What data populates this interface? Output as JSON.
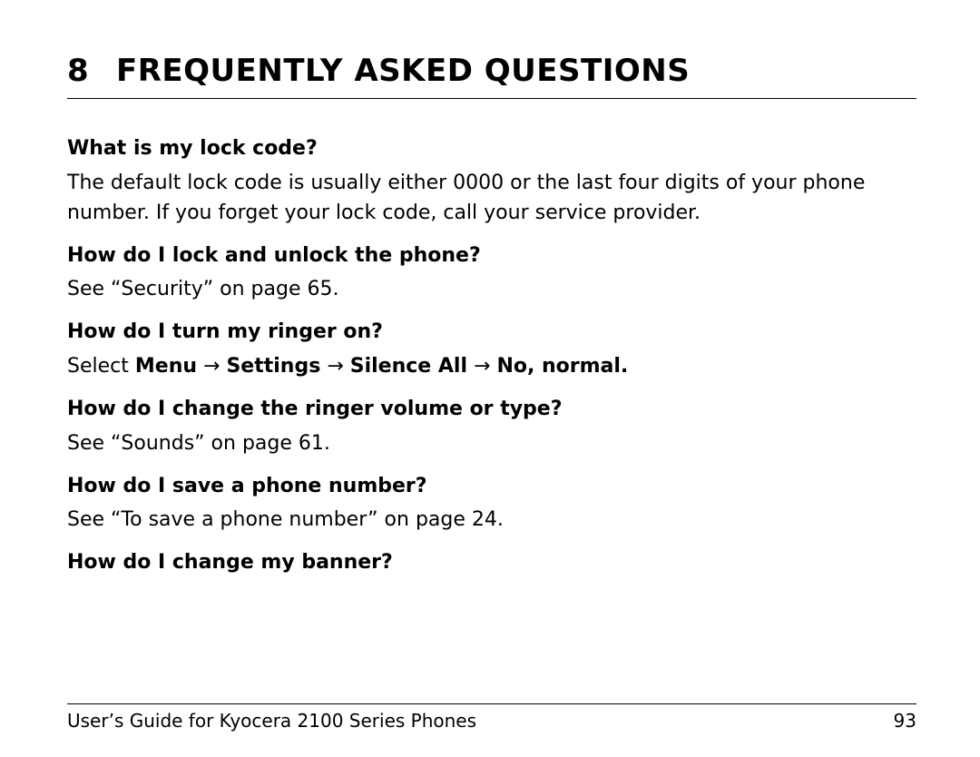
{
  "chapter": {
    "number": "8",
    "title": "FREQUENTLY ASKED QUESTIONS"
  },
  "faq": [
    {
      "q": "What is my lock code?",
      "a_plain": "The default lock code is usually either 0000 or the last four digits of your phone number. If you forget your lock code, call your service provider."
    },
    {
      "q": "How do I lock and unlock the phone?",
      "a_plain": "See “Security” on page 65."
    },
    {
      "q": "How do I turn my ringer on?",
      "a_prefix": "Select ",
      "a_path": [
        "Menu",
        "Settings",
        "Silence All",
        "No, normal."
      ]
    },
    {
      "q": "How do I change the ringer volume or type?",
      "a_plain": "See “Sounds” on page 61."
    },
    {
      "q": "How do I save a phone number?",
      "a_plain": "See “To save a phone number” on page 24."
    },
    {
      "q": "How do I change my banner?"
    }
  ],
  "footer": {
    "left": "User’s Guide for Kyocera 2100 Series Phones",
    "right": "93"
  },
  "arrow_glyph": "→"
}
